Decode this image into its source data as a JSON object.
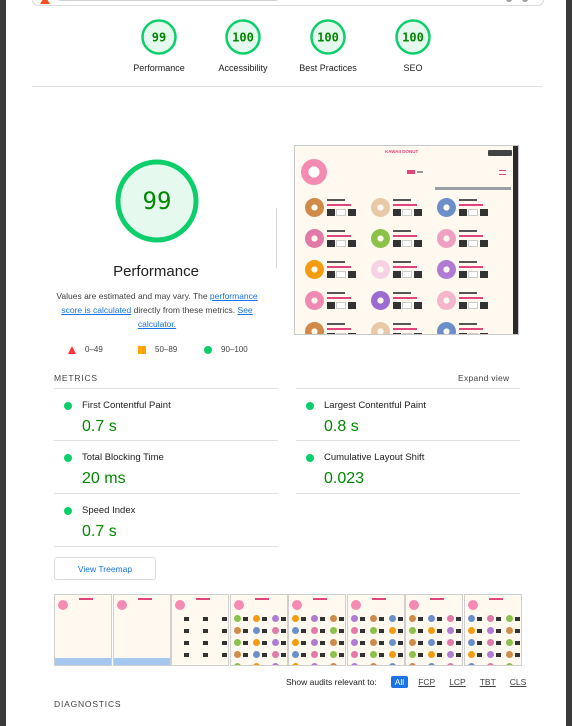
{
  "top_scores": [
    {
      "score": "99",
      "label": "Performance"
    },
    {
      "score": "100",
      "label": "Accessibility"
    },
    {
      "score": "100",
      "label": "Best Practices"
    },
    {
      "score": "100",
      "label": "SEO"
    }
  ],
  "performance": {
    "score": "99",
    "title": "Performance",
    "note_pre": "Values are estimated and may vary. The ",
    "note_link1": "performance score is calculated",
    "note_mid": " directly from these metrics. ",
    "note_link2": "See calculator."
  },
  "legend": [
    {
      "range": "0–49",
      "icon": "red-triangle-icon"
    },
    {
      "range": "50–89",
      "icon": "orange-square-icon"
    },
    {
      "range": "90–100",
      "icon": "green-circle-icon"
    }
  ],
  "preview": {
    "site_title": "KAWAII DONUT"
  },
  "metrics": {
    "heading": "METRICS",
    "expand_label": "Expand view",
    "items": [
      {
        "label": "First Contentful Paint",
        "value": "0.7 s"
      },
      {
        "label": "Largest Contentful Paint",
        "value": "0.8 s"
      },
      {
        "label": "Total Blocking Time",
        "value": "20 ms"
      },
      {
        "label": "Cumulative Layout Shift",
        "value": "0.023"
      },
      {
        "label": "Speed Index",
        "value": "0.7 s"
      }
    ]
  },
  "treemap_label": "View Treemap",
  "audits": {
    "label": "Show audits relevant to:",
    "filters": [
      "All",
      "FCP",
      "LCP",
      "TBT",
      "CLS"
    ],
    "active": "All"
  },
  "diagnostics_heading": "DIAGNOSTICS",
  "colors": {
    "pass": "#0cce6b",
    "pass_text": "#008800",
    "link": "#1a73e8",
    "fail": "#ff3333",
    "average": "#ffa400"
  }
}
